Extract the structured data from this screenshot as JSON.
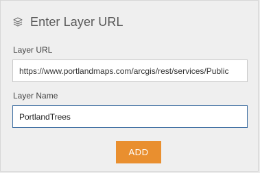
{
  "dialog": {
    "title": "Enter Layer URL",
    "title_icon": "layers-icon"
  },
  "fields": {
    "url": {
      "label": "Layer URL",
      "value": "https://www.portlandmaps.com/arcgis/rest/services/Public"
    },
    "name": {
      "label": "Layer Name",
      "value": "PortlandTrees"
    }
  },
  "actions": {
    "add_label": "ADD"
  },
  "colors": {
    "accent": "#e98f2f",
    "focus_border": "#3e6ea1"
  }
}
